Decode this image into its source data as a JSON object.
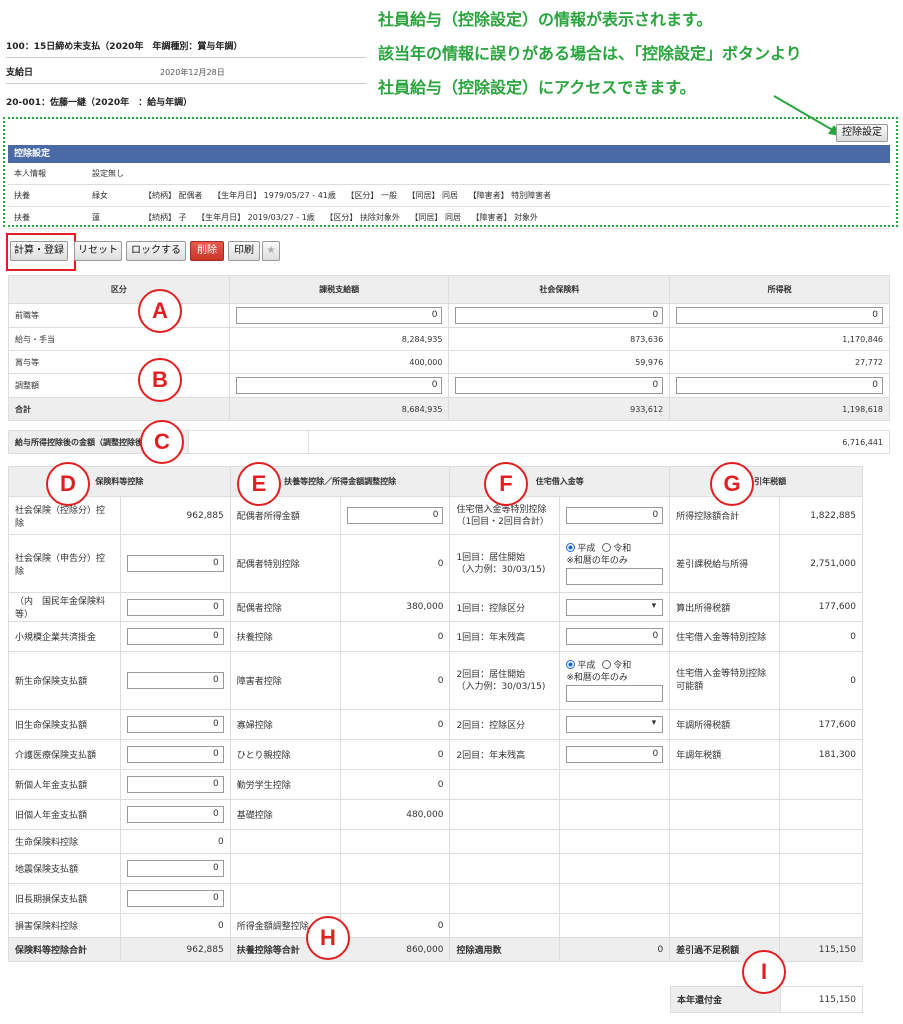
{
  "header": {
    "line1": "100：15日締め末支払（2020年　年調種別：賞与年調）",
    "payday_label": "支給日",
    "payday_value": "2020年12月28日",
    "employee": "20-001：佐藤一継（2020年　：給与年調）"
  },
  "callout": {
    "line1": "社員給与（控除設定）の情報が表示されます。",
    "line2": "該当年の情報に誤りがある場合は、「控除設定」ボタンより",
    "line3": "社員給与（控除設定）にアクセスできます。",
    "color": "#2aa53e"
  },
  "deduction_panel": {
    "button_label": "控除設定",
    "title": "控除設定",
    "rows": [
      {
        "label": "本人情報",
        "c1": "設定無し",
        "c2": ""
      },
      {
        "label": "扶養",
        "c1": "緑女",
        "c2": "【続柄】 配偶者　 【生年月日】 1979/05/27 - 41歳　 【区分】 一般　 【同居】 同居　 【障害者】 特別障害者"
      },
      {
        "label": "扶養",
        "c1": "蓮",
        "c2": "【続柄】 子　 【生年月日】 2019/03/27 - 1歳　 【区分】 扶除対象外　 【同居】 同居　 【障害者】 対象外"
      }
    ]
  },
  "toolbar": {
    "calc_label": "計算・登録",
    "reset_label": "リセット",
    "lock_label": "ロックする",
    "delete_label": "削除",
    "print_label": "印刷",
    "star_icon": "star-icon"
  },
  "summary": {
    "headers": [
      "区分",
      "課税支給額",
      "社会保険料",
      "所得税"
    ],
    "rows": [
      {
        "label": "前職等",
        "v1": "0",
        "v2": "0",
        "v3": "0",
        "input": true
      },
      {
        "label": "給与・手当",
        "v1": "8,284,935",
        "v2": "873,636",
        "v3": "1,170,846",
        "input": false
      },
      {
        "label": "賞与等",
        "v1": "400,000",
        "v2": "59,976",
        "v3": "27,772",
        "input": false
      },
      {
        "label": "調整額",
        "v1": "0",
        "v2": "0",
        "v3": "0",
        "input": true
      },
      {
        "label": "合計",
        "v1": "8,684,935",
        "v2": "933,612",
        "v3": "1,198,618",
        "input": false
      }
    ],
    "after_deduction_label": "給与所得控除後の金額（調整控除後）",
    "after_deduction_value": "6,716,441"
  },
  "circles": {
    "A": "A",
    "B": "B",
    "C": "C",
    "D": "D",
    "E": "E",
    "F": "F",
    "G": "G",
    "H": "H",
    "I": "I",
    "color": "#e02020"
  },
  "sections": {
    "insurance_title": "保険料等控除",
    "dependent_title": "扶養等控除／所得金額調整控除",
    "housing_title": "住宅借入金等",
    "tax_title": "差引年税額"
  },
  "rows": {
    "r1": {
      "c1": "社会保険（控除分）控除",
      "c1v": "962,885",
      "c2": "配偶者所得金額",
      "c2v": "0",
      "c3": "住宅借入金等特別控除\n（1回目・2回目合計）",
      "c3v": "0",
      "c4": "所得控除額合計",
      "c4v": "1,822,885"
    },
    "r2": {
      "c1": "社会保険（申告分）控除",
      "c1v": "0",
      "c2": "配偶者特別控除",
      "c2v": "0",
      "c3": "1回目：居住開始\n（入力例：30/03/15)",
      "radio1": "平成",
      "radio2": "令和",
      "note": "※和暦の年のみ",
      "c4": "差引課税給与所得",
      "c4v": "2,751,000"
    },
    "r3": {
      "c1": "（内　国民年金保険料等）",
      "c1v": "0",
      "c2": "配偶者控除",
      "c2v": "380,000",
      "c3": "1回目：控除区分",
      "c4": "算出所得税額",
      "c4v": "177,600"
    },
    "r4": {
      "c1": "小規模企業共済掛金",
      "c1v": "0",
      "c2": "扶養控除",
      "c2v": "0",
      "c3": "1回目：年末残高",
      "c3v": "0",
      "c4": "住宅借入金等特別控除",
      "c4v": "0"
    },
    "r5": {
      "c1": "新生命保険支払額",
      "c1v": "0",
      "c2": "障害者控除",
      "c2v": "0",
      "c3": "2回目：居住開始\n（入力例：30/03/15)",
      "radio1": "平成",
      "radio2": "令和",
      "note": "※和暦の年のみ",
      "c4": "住宅借入金等特別控除可能額",
      "c4v": "0"
    },
    "r6": {
      "c1": "旧生命保険支払額",
      "c1v": "0",
      "c2": "寡婦控除",
      "c2v": "0",
      "c3": "2回目：控除区分",
      "c4": "年調所得税額",
      "c4v": "177,600"
    },
    "r7": {
      "c1": "介護医療保険支払額",
      "c1v": "0",
      "c2": "ひとり親控除",
      "c2v": "0",
      "c3": "2回目：年末残高",
      "c3v": "0",
      "c4": "年調年税額",
      "c4v": "181,300"
    },
    "r8": {
      "c1": "新個人年金支払額",
      "c1v": "0",
      "c2": "勤労学生控除",
      "c2v": "0"
    },
    "r9": {
      "c1": "旧個人年金支払額",
      "c1v": "0",
      "c2": "基礎控除",
      "c2v": "480,000"
    },
    "r10": {
      "c1": "生命保険料控除",
      "c1v": "0"
    },
    "r11": {
      "c1": "地震保険支払額",
      "c1v": "0"
    },
    "r12": {
      "c1": "旧長期損保支払額",
      "c1v": "0"
    },
    "r13": {
      "c1": "損害保険料控除",
      "c1v": "0",
      "c2": "所得金額調整控除",
      "c2v": "0"
    },
    "total": {
      "c1": "保険料等控除合計",
      "c1v": "962,885",
      "c2": "扶養控除等合計",
      "c2v": "860,000",
      "c3": "控除適用数",
      "c3v": "0",
      "c4": "差引過不足税額",
      "c4v": "115,150"
    },
    "refund": {
      "label": "本年還付金",
      "value": "115,150"
    }
  }
}
